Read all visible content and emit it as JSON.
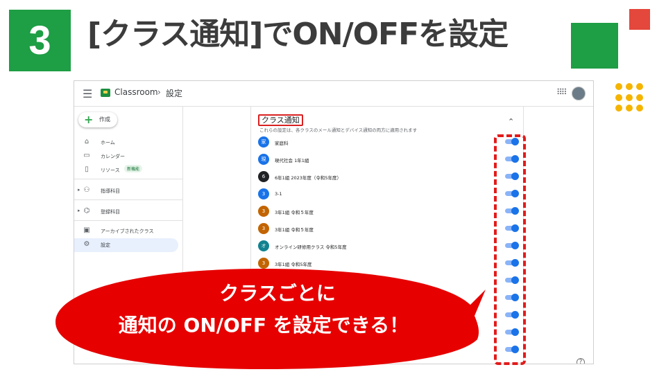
{
  "slide": {
    "step_number": "3",
    "title": "[クラス通知]でON/OFFを設定",
    "callout_line1": "クラスごとに",
    "callout_line2": "通知の ON/OFF を設定できる！",
    "colors": {
      "green": "#1e9e45",
      "red": "#e4473b",
      "yellow": "#f5b400",
      "callout": "#e60000"
    }
  },
  "app": {
    "name": "Classroom",
    "breadcrumb_sep": "›",
    "page": "設定",
    "icons": {
      "menu": "hamburger-icon",
      "apps": "apps-grid-icon",
      "help": "help-icon"
    }
  },
  "sidebar": {
    "create_label": "作成",
    "items": [
      {
        "label": "ホーム",
        "icon": "home-icon"
      },
      {
        "label": "カレンダー",
        "icon": "calendar-icon"
      },
      {
        "label": "リソース",
        "icon": "resources-icon",
        "badge": "新機能"
      },
      {
        "label": "指導科目",
        "icon": "teaching-icon"
      },
      {
        "label": "登録科目",
        "icon": "enrolled-icon"
      },
      {
        "label": "アーカイブされたクラス",
        "icon": "archive-icon"
      },
      {
        "label": "設定",
        "icon": "settings-gear-icon",
        "active": true
      }
    ]
  },
  "settings": {
    "section_title": "クラス通知",
    "description": "これらの設定は、各クラスのメール通知とデバイス通知の両方に適用されます",
    "classes": [
      {
        "initial": "家",
        "name": "家庭科",
        "color": "#1a73e8",
        "enabled": true
      },
      {
        "initial": "現",
        "name": "現代社会 1年1組",
        "color": "#1a73e8",
        "enabled": true
      },
      {
        "initial": "6",
        "name": "6年1組 2023年度（令和5年度）",
        "color": "#202124",
        "enabled": true
      },
      {
        "initial": "3",
        "name": "3-1",
        "color": "#1a73e8",
        "enabled": true
      },
      {
        "initial": "3",
        "name": "3年1組 令和５年度",
        "color": "#c26401",
        "enabled": true
      },
      {
        "initial": "3",
        "name": "3年1組 令和５年度",
        "color": "#c26401",
        "enabled": true
      },
      {
        "initial": "オ",
        "name": "オンライン研修用クラス 令和5年度",
        "color": "#12828f",
        "enabled": true
      },
      {
        "initial": "3",
        "name": "3年1組 令和5年度",
        "color": "#c26401",
        "enabled": true
      },
      {
        "initial": "",
        "name": "",
        "color": "#1a73e8",
        "enabled": true
      },
      {
        "initial": "",
        "name": "",
        "color": "#1a73e8",
        "enabled": true
      },
      {
        "initial": "",
        "name": "",
        "color": "#1a73e8",
        "enabled": true
      },
      {
        "initial": "",
        "name": "",
        "color": "#1a73e8",
        "enabled": true
      },
      {
        "initial": "",
        "name": "",
        "color": "#1a73e8",
        "enabled": true
      }
    ]
  }
}
